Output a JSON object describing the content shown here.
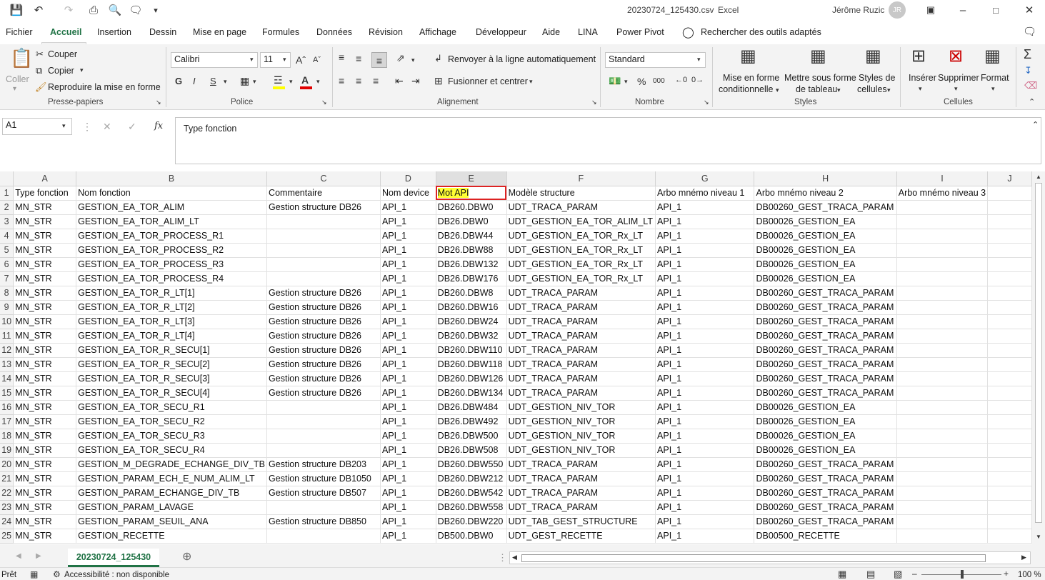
{
  "app": {
    "file_name": "20230724_125430.csv",
    "app_name": "Excel",
    "user": "Jérôme Ruzic",
    "user_initials": "JR",
    "accent": "#217346"
  },
  "menu": [
    "Fichier",
    "Accueil",
    "Insertion",
    "Dessin",
    "Mise en page",
    "Formules",
    "Données",
    "Révision",
    "Affichage",
    "Développeur",
    "Aide",
    "LINA",
    "Power Pivot"
  ],
  "search": "Rechercher des outils adaptés",
  "ribbon": {
    "clipboard": {
      "paste": "Coller",
      "cut": "Couper",
      "copy": "Copier",
      "painter": "Reproduire la mise en forme",
      "label": "Presse-papiers"
    },
    "font": {
      "name": "Calibri",
      "size": "11",
      "bold": "G",
      "italic": "I",
      "underline": "S",
      "label": "Police"
    },
    "alignment": {
      "wrap": "Renvoyer à la ligne automatiquement",
      "merge": "Fusionner et centrer",
      "label": "Alignement"
    },
    "number": {
      "format": "Standard",
      "percent": "%",
      "thousands": "000",
      "label": "Nombre"
    },
    "styles": {
      "conditional": "Mise en forme",
      "conditional2": "conditionnelle",
      "table": "Mettre sous forme",
      "table2": "de tableau",
      "cell": "Styles de",
      "cell2": "cellules",
      "label": "Styles"
    },
    "cells": {
      "insert": "Insérer",
      "delete": "Supprimer",
      "format": "Format",
      "label": "Cellules"
    }
  },
  "formula_bar": {
    "name_box": "A1",
    "fx": "fx",
    "content": "Type fonction"
  },
  "columns": [
    "A",
    "B",
    "C",
    "D",
    "E",
    "F",
    "G",
    "H",
    "I",
    "J"
  ],
  "rows": [
    [
      "Type fonction",
      "Nom fonction",
      "Commentaire",
      "Nom device",
      "Mot API",
      "Modèle structure",
      "Arbo mnémo niveau 1",
      "Arbo mnémo niveau 2",
      "Arbo mnémo niveau 3",
      ""
    ],
    [
      "MN_STR",
      "GESTION_EA_TOR_ALIM",
      "Gestion structure DB26",
      "API_1",
      "DB260.DBW0",
      "UDT_TRACA_PARAM",
      "API_1",
      "DB00260_GEST_TRACA_PARAM",
      "",
      ""
    ],
    [
      "MN_STR",
      "GESTION_EA_TOR_ALIM_LT",
      "",
      "API_1",
      "DB26.DBW0",
      "UDT_GESTION_EA_TOR_ALIM_LT",
      "API_1",
      "DB00026_GESTION_EA",
      "",
      ""
    ],
    [
      "MN_STR",
      "GESTION_EA_TOR_PROCESS_R1",
      "",
      "API_1",
      "DB26.DBW44",
      "UDT_GESTION_EA_TOR_Rx_LT",
      "API_1",
      "DB00026_GESTION_EA",
      "",
      ""
    ],
    [
      "MN_STR",
      "GESTION_EA_TOR_PROCESS_R2",
      "",
      "API_1",
      "DB26.DBW88",
      "UDT_GESTION_EA_TOR_Rx_LT",
      "API_1",
      "DB00026_GESTION_EA",
      "",
      ""
    ],
    [
      "MN_STR",
      "GESTION_EA_TOR_PROCESS_R3",
      "",
      "API_1",
      "DB26.DBW132",
      "UDT_GESTION_EA_TOR_Rx_LT",
      "API_1",
      "DB00026_GESTION_EA",
      "",
      ""
    ],
    [
      "MN_STR",
      "GESTION_EA_TOR_PROCESS_R4",
      "",
      "API_1",
      "DB26.DBW176",
      "UDT_GESTION_EA_TOR_Rx_LT",
      "API_1",
      "DB00026_GESTION_EA",
      "",
      ""
    ],
    [
      "MN_STR",
      "GESTION_EA_TOR_R_LT[1]",
      "Gestion structure DB26",
      "API_1",
      "DB260.DBW8",
      "UDT_TRACA_PARAM",
      "API_1",
      "DB00260_GEST_TRACA_PARAM",
      "",
      ""
    ],
    [
      "MN_STR",
      "GESTION_EA_TOR_R_LT[2]",
      "Gestion structure DB26",
      "API_1",
      "DB260.DBW16",
      "UDT_TRACA_PARAM",
      "API_1",
      "DB00260_GEST_TRACA_PARAM",
      "",
      ""
    ],
    [
      "MN_STR",
      "GESTION_EA_TOR_R_LT[3]",
      "Gestion structure DB26",
      "API_1",
      "DB260.DBW24",
      "UDT_TRACA_PARAM",
      "API_1",
      "DB00260_GEST_TRACA_PARAM",
      "",
      ""
    ],
    [
      "MN_STR",
      "GESTION_EA_TOR_R_LT[4]",
      "Gestion structure DB26",
      "API_1",
      "DB260.DBW32",
      "UDT_TRACA_PARAM",
      "API_1",
      "DB00260_GEST_TRACA_PARAM",
      "",
      ""
    ],
    [
      "MN_STR",
      "GESTION_EA_TOR_R_SECU[1]",
      "Gestion structure DB26",
      "API_1",
      "DB260.DBW110",
      "UDT_TRACA_PARAM",
      "API_1",
      "DB00260_GEST_TRACA_PARAM",
      "",
      ""
    ],
    [
      "MN_STR",
      "GESTION_EA_TOR_R_SECU[2]",
      "Gestion structure DB26",
      "API_1",
      "DB260.DBW118",
      "UDT_TRACA_PARAM",
      "API_1",
      "DB00260_GEST_TRACA_PARAM",
      "",
      ""
    ],
    [
      "MN_STR",
      "GESTION_EA_TOR_R_SECU[3]",
      "Gestion structure DB26",
      "API_1",
      "DB260.DBW126",
      "UDT_TRACA_PARAM",
      "API_1",
      "DB00260_GEST_TRACA_PARAM",
      "",
      ""
    ],
    [
      "MN_STR",
      "GESTION_EA_TOR_R_SECU[4]",
      "Gestion structure DB26",
      "API_1",
      "DB260.DBW134",
      "UDT_TRACA_PARAM",
      "API_1",
      "DB00260_GEST_TRACA_PARAM",
      "",
      ""
    ],
    [
      "MN_STR",
      "GESTION_EA_TOR_SECU_R1",
      "",
      "API_1",
      "DB26.DBW484",
      "UDT_GESTION_NIV_TOR",
      "API_1",
      "DB00026_GESTION_EA",
      "",
      ""
    ],
    [
      "MN_STR",
      "GESTION_EA_TOR_SECU_R2",
      "",
      "API_1",
      "DB26.DBW492",
      "UDT_GESTION_NIV_TOR",
      "API_1",
      "DB00026_GESTION_EA",
      "",
      ""
    ],
    [
      "MN_STR",
      "GESTION_EA_TOR_SECU_R3",
      "",
      "API_1",
      "DB26.DBW500",
      "UDT_GESTION_NIV_TOR",
      "API_1",
      "DB00026_GESTION_EA",
      "",
      ""
    ],
    [
      "MN_STR",
      "GESTION_EA_TOR_SECU_R4",
      "",
      "API_1",
      "DB26.DBW508",
      "UDT_GESTION_NIV_TOR",
      "API_1",
      "DB00026_GESTION_EA",
      "",
      ""
    ],
    [
      "MN_STR",
      "GESTION_M_DEGRADE_ECHANGE_DIV_TB",
      "Gestion structure DB203",
      "API_1",
      "DB260.DBW550",
      "UDT_TRACA_PARAM",
      "API_1",
      "DB00260_GEST_TRACA_PARAM",
      "",
      ""
    ],
    [
      "MN_STR",
      "GESTION_PARAM_ECH_E_NUM_ALIM_LT",
      "Gestion structure DB1050",
      "API_1",
      "DB260.DBW212",
      "UDT_TRACA_PARAM",
      "API_1",
      "DB00260_GEST_TRACA_PARAM",
      "",
      ""
    ],
    [
      "MN_STR",
      "GESTION_PARAM_ECHANGE_DIV_TB",
      "Gestion structure DB507",
      "API_1",
      "DB260.DBW542",
      "UDT_TRACA_PARAM",
      "API_1",
      "DB00260_GEST_TRACA_PARAM",
      "",
      ""
    ],
    [
      "MN_STR",
      "GESTION_PARAM_LAVAGE",
      "",
      "API_1",
      "DB260.DBW558",
      "UDT_TRACA_PARAM",
      "API_1",
      "DB00260_GEST_TRACA_PARAM",
      "",
      ""
    ],
    [
      "MN_STR",
      "GESTION_PARAM_SEUIL_ANA",
      "Gestion structure DB850",
      "API_1",
      "DB260.DBW220",
      "UDT_TAB_GEST_STRUCTURE",
      "API_1",
      "DB00260_GEST_TRACA_PARAM",
      "",
      ""
    ],
    [
      "MN_STR",
      "GESTION_RECETTE",
      "",
      "API_1",
      "DB500.DBW0",
      "UDT_GEST_RECETTE",
      "API_1",
      "DB00500_RECETTE",
      "",
      ""
    ]
  ],
  "sheet_tab": "20230724_125430",
  "status": {
    "ready": "Prêt",
    "accessibility": "Accessibilité : non disponible",
    "zoom": "100 %"
  }
}
